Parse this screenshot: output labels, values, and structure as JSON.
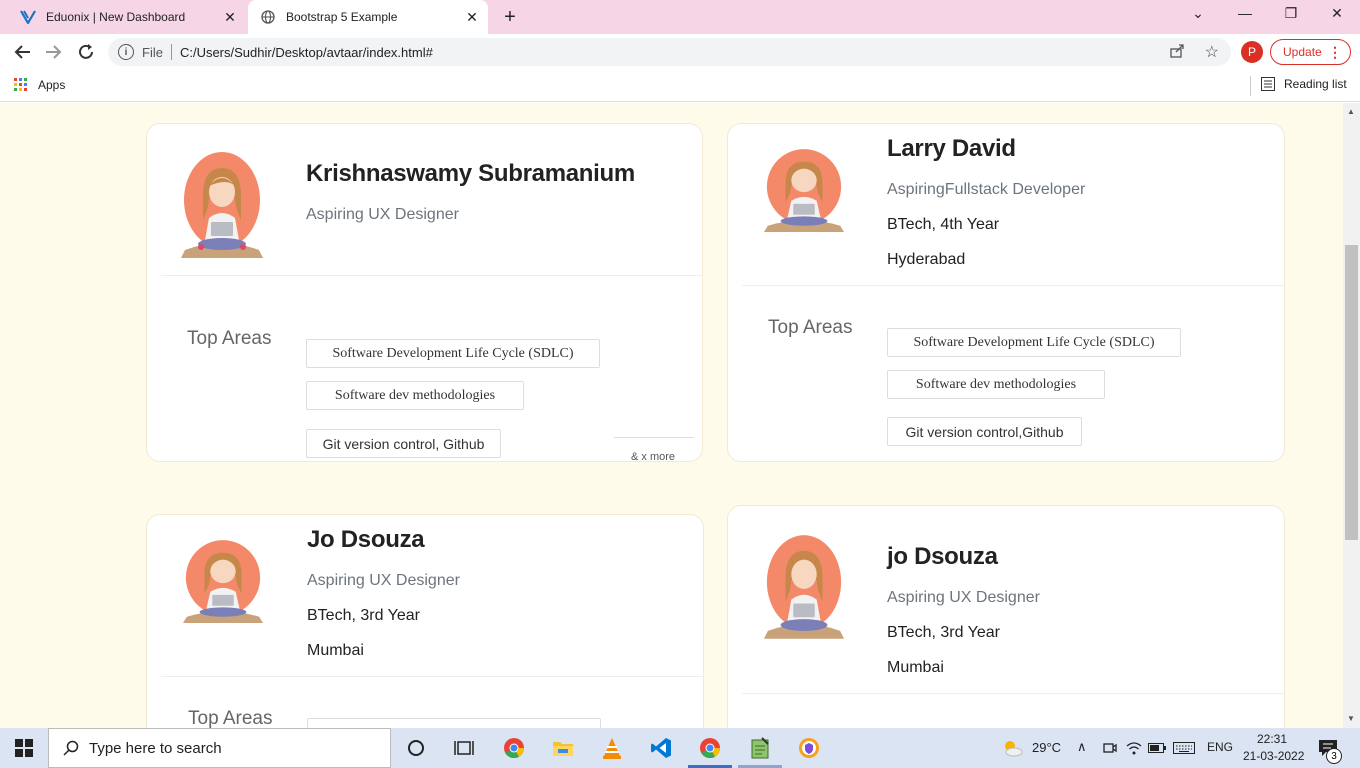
{
  "browser": {
    "tabs": [
      {
        "title": "Eduonix | New Dashboard",
        "icon": "eduonix-logo-icon"
      },
      {
        "title": "Bootstrap 5 Example",
        "icon": "globe-icon"
      }
    ],
    "address": {
      "scheme": "File",
      "url": "C:/Users/Sudhir/Desktop/avtaar/index.html#"
    },
    "profile_initial": "P",
    "update_label": "Update",
    "bookmarks": {
      "apps_label": "Apps",
      "reading_list_label": "Reading list"
    }
  },
  "cards": [
    {
      "name": "Krishnaswamy Subramanium",
      "role": "Aspiring UX Designer",
      "areas_label": "Top Areas",
      "areas": [
        "Software Development Life Cycle (SDLC)",
        "Software dev methodologies",
        "Git version control, Github"
      ],
      "more_label": "& x more"
    },
    {
      "name": "Larry David",
      "role": "AspiringFullstack Developer",
      "education": "BTech, 4th Year",
      "location": "Hyderabad",
      "areas_label": "Top Areas",
      "areas": [
        "Software Development Life Cycle (SDLC)",
        "Software dev methodologies",
        "Git version control,Github"
      ]
    },
    {
      "name": "Jo Dsouza",
      "role": "Aspiring UX Designer",
      "education": "BTech, 3rd Year",
      "location": "Mumbai",
      "areas_label": "Top Areas"
    },
    {
      "name": "jo Dsouza",
      "role": "Aspiring UX Designer",
      "education": "BTech, 3rd Year",
      "location": "Mumbai"
    }
  ],
  "taskbar": {
    "search_placeholder": "Type here to search",
    "weather": "29°C",
    "language": "ENG",
    "time": "22:31",
    "date": "21-03-2022",
    "notification_count": "3"
  },
  "colors": {
    "page_bg": "#fffbea",
    "tabbar_bg": "#f6d6e6",
    "update_red": "#d93025"
  }
}
